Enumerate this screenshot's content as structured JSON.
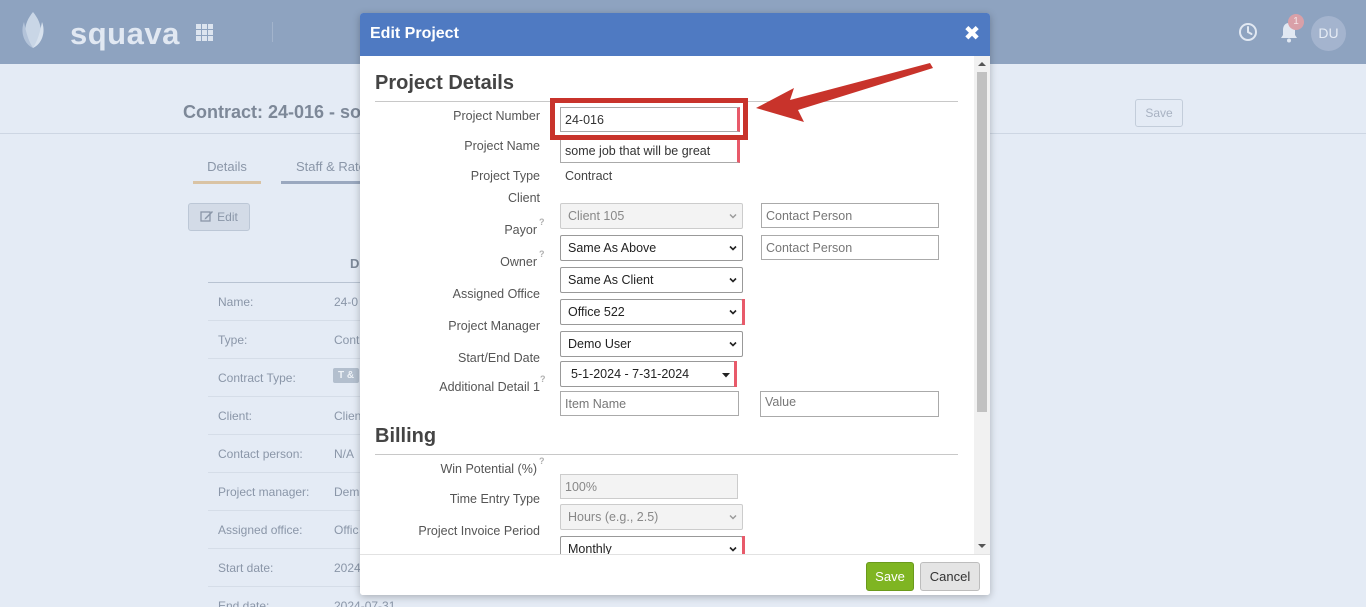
{
  "app": {
    "logo_text": "squava",
    "notification_count": "1",
    "avatar_initials": "DU"
  },
  "page": {
    "title": "Contract: 24-016 - som",
    "save_label": "Save",
    "tabs": [
      {
        "label": "Details"
      },
      {
        "label": "Staff & Rate"
      }
    ],
    "edit_label": "Edit",
    "section_head": "D",
    "rows": [
      {
        "label": "Name:",
        "value": "24-0"
      },
      {
        "label": "Type:",
        "value": "Cont"
      },
      {
        "label": "Contract Type:",
        "value": "T &"
      },
      {
        "label": "Client:",
        "value": "Clien"
      },
      {
        "label": "Contact person:",
        "value": "N/A"
      },
      {
        "label": "Project manager:",
        "value": "Dem"
      },
      {
        "label": "Assigned office:",
        "value": "Offic"
      },
      {
        "label": "Start date:",
        "value": "2024"
      },
      {
        "label": "End date:",
        "value": "2024-07-31"
      }
    ]
  },
  "modal": {
    "title": "Edit Project",
    "close_glyph": "✖",
    "sections": {
      "project_details": "Project Details",
      "billing": "Billing"
    },
    "fields": {
      "project_number": {
        "label": "Project Number",
        "value": "24-016"
      },
      "project_name": {
        "label": "Project Name",
        "value": "some job that will be great"
      },
      "project_type": {
        "label": "Project Type",
        "value": "Contract"
      },
      "client": {
        "label": "Client",
        "value": "Client 105",
        "contact_placeholder": "Contact Person"
      },
      "payor": {
        "label": "Payor",
        "value": "Same As Above",
        "contact_placeholder": "Contact Person"
      },
      "owner": {
        "label": "Owner",
        "value": "Same As Client"
      },
      "assigned_office": {
        "label": "Assigned Office",
        "value": "Office 522"
      },
      "project_manager": {
        "label": "Project Manager",
        "value": "Demo User"
      },
      "start_end_date": {
        "label": "Start/End Date",
        "value": "5-1-2024 - 7-31-2024"
      },
      "additional_detail": {
        "label": "Additional Detail 1",
        "name_placeholder": "Item Name",
        "value_placeholder": "Value"
      },
      "win_potential": {
        "label": "Win Potential (%)",
        "value": "100%"
      },
      "time_entry_type": {
        "label": "Time Entry Type",
        "value": "Hours (e.g., 2.5)"
      },
      "invoice_period": {
        "label": "Project Invoice Period",
        "value": "Monthly"
      }
    },
    "help_glyph": "?",
    "save_label": "Save",
    "cancel_label": "Cancel"
  },
  "colors": {
    "header_blue": "#4f7ac2",
    "save_green": "#7fb522",
    "required_red": "#e85a6a",
    "annotation_red": "#c8332b"
  }
}
